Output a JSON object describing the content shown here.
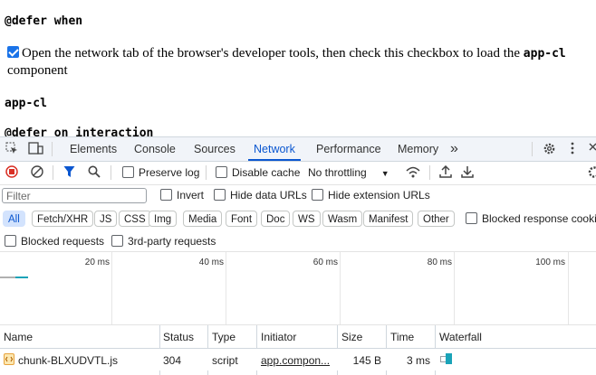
{
  "page": {
    "heading1": "@defer when",
    "checkbox_text": "Open the network tab of the browser's developer tools, then check this checkbox to load the ",
    "checkbox_bold": "app-cl",
    "checkbox_tail": " component",
    "app_label": "app-cl",
    "heading2": "@defer on interaction"
  },
  "devtools": {
    "tabs": [
      "Elements",
      "Console",
      "Sources",
      "Network",
      "Performance",
      "Memory"
    ],
    "active_tab": "Network",
    "more_tabs": "»",
    "toolbar": {
      "preserve_log": "Preserve log",
      "disable_cache": "Disable cache",
      "throttling": "No throttling"
    },
    "filter": {
      "placeholder": "Filter",
      "invert": "Invert",
      "hide_data_urls": "Hide data URLs",
      "hide_extension_urls": "Hide extension URLs"
    },
    "types": [
      "All",
      "Fetch/XHR",
      "JS",
      "CSS",
      "Img",
      "Media",
      "Font",
      "Doc",
      "WS",
      "Wasm",
      "Manifest",
      "Other"
    ],
    "blocked_response_cookies": "Blocked response cookies",
    "blocked_requests": "Blocked requests",
    "third_party_requests": "3rd-party requests",
    "timeline": [
      "20 ms",
      "40 ms",
      "60 ms",
      "80 ms",
      "100 ms"
    ],
    "columns": [
      "Name",
      "Status",
      "Type",
      "Initiator",
      "Size",
      "Time",
      "Waterfall"
    ],
    "rows": [
      {
        "name": "chunk-BLXUDVTL.js",
        "status": "304",
        "type": "script",
        "initiator": "app.compon...",
        "size": "145 B",
        "time": "3 ms"
      }
    ],
    "colors": {
      "accent": "#0b57d0",
      "record": "#d93025",
      "waterfall": "#1aa3b8"
    }
  }
}
